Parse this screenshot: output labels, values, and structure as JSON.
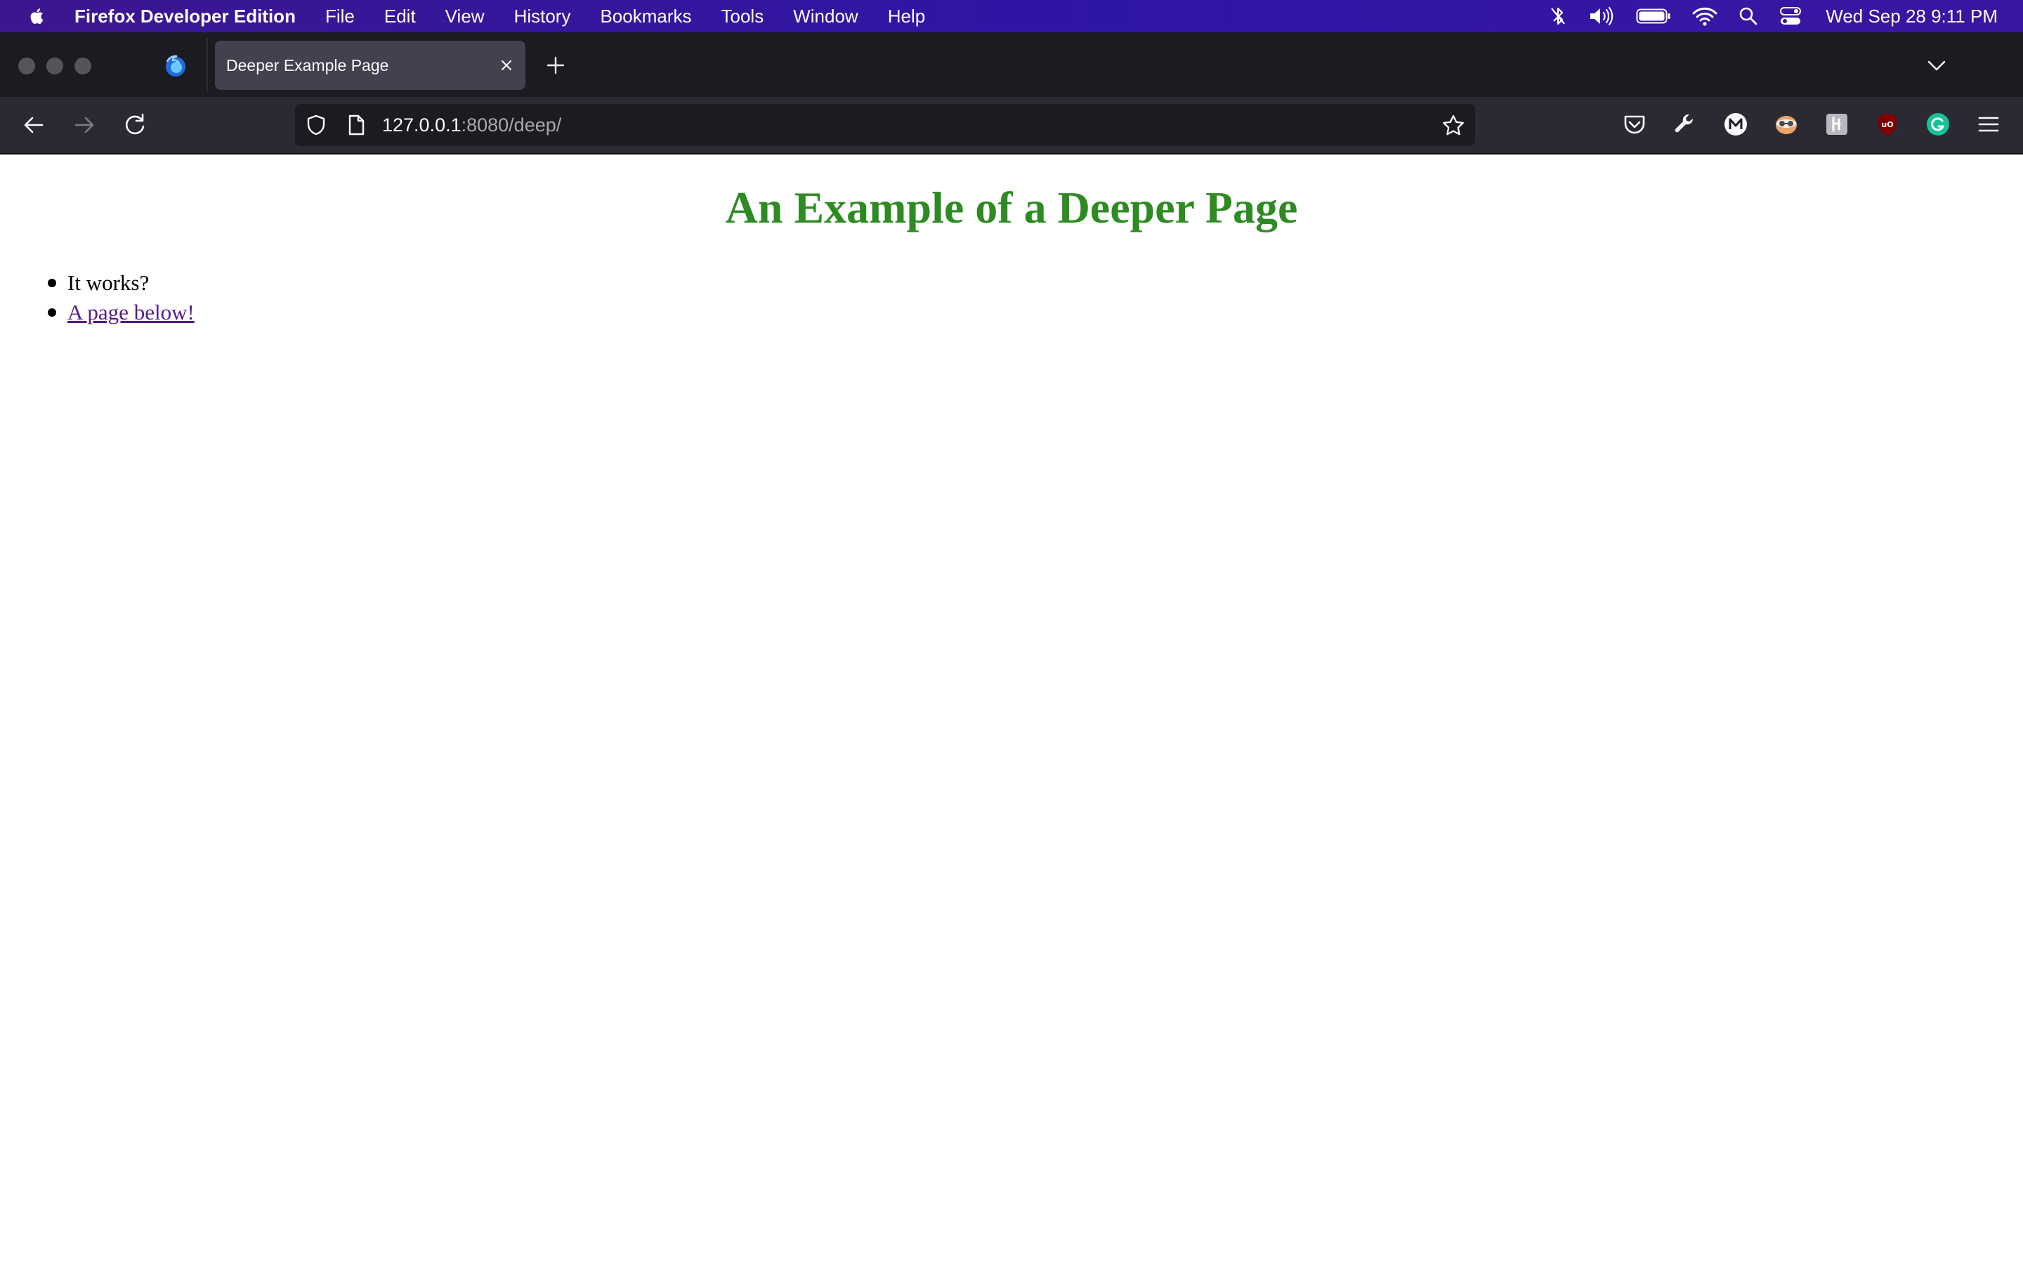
{
  "menubar": {
    "app_name": "Firefox Developer Edition",
    "items": [
      "File",
      "Edit",
      "View",
      "History",
      "Bookmarks",
      "Tools",
      "Window",
      "Help"
    ],
    "clock": "Wed Sep 28  9:11 PM",
    "status_icons": [
      "bluetooth-off-icon",
      "volume-icon",
      "battery-icon",
      "wifi-icon",
      "spotlight-search-icon",
      "control-center-icon"
    ]
  },
  "browser": {
    "tab": {
      "title": "Deeper Example Page"
    },
    "url": {
      "host": "127.0.0.1",
      "rest": ":8080/deep/"
    },
    "extensions": [
      "pocket-icon",
      "developer-tools-icon",
      "m-extension-icon",
      "privacy-badger-icon",
      "extension-icon",
      "ublock-origin-icon",
      "grammarly-icon",
      "app-menu-icon"
    ]
  },
  "page": {
    "title": "An Example of a Deeper Page",
    "items": [
      {
        "text": "It works?"
      },
      {
        "text": "A page below!"
      }
    ]
  },
  "colors": {
    "menubar": "#3b1690",
    "tabstrip": "#1c1b22",
    "toolbar": "#2b2a33",
    "heading": "#2e8b22",
    "visited_link": "#551a8b"
  }
}
